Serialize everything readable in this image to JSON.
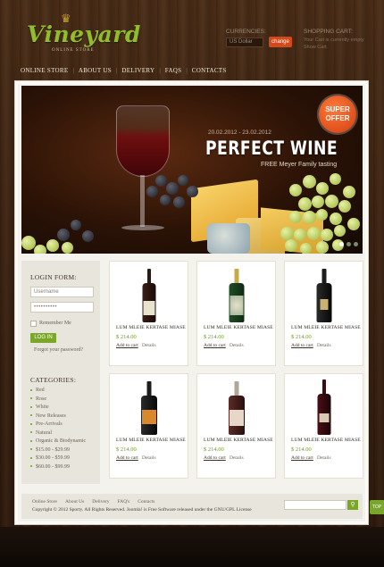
{
  "brand": {
    "name": "Vineyard",
    "tagline": "ONLINE STORE"
  },
  "header": {
    "currencies_label": "CURRENCIES:",
    "currency_selected": "US Dollar",
    "change_label": "change",
    "cart_label": "SHOPPING CART:",
    "cart_line1": "Your Cart is currently empty",
    "cart_line2": "Show Cart"
  },
  "nav": [
    "ONLINE STORE",
    "ABOUT US",
    "DELIVERY",
    "FAQS",
    "CONTACTS"
  ],
  "slider": {
    "date_range": "20.02.2012 - 23.02.2012",
    "title": "PERFECT WINE",
    "subtitle": "FREE Meyer Family tasting",
    "badge_line1": "SUPER",
    "badge_line2": "OFFER"
  },
  "login": {
    "title": "LOGIN FORM:",
    "username_placeholder": "Username",
    "password_value": "••••••••••",
    "remember_label": "Remember Me",
    "login_button": "LOG IN",
    "forgot_link": "Forgot your password?"
  },
  "categories": {
    "title": "CATEGORIES:",
    "items": [
      "Red",
      "Rose",
      "White",
      "New Releases",
      "Pre-Arrivals",
      "Natural",
      "Organic & Biodynamic",
      "$15.00 - $29.99",
      "$30.00 - $59.99",
      "$60.00 - $99.99"
    ]
  },
  "products": [
    {
      "name": "LUM MLEIE KERTASE MIASE",
      "price": "$ 214.00",
      "add": "Add to cart",
      "details": "Details"
    },
    {
      "name": "LUM MLEIE KERTASE MIASE",
      "price": "$ 214.00",
      "add": "Add to cart",
      "details": "Details"
    },
    {
      "name": "LUM MLEIE KERTASE MIASE",
      "price": "$ 214.00",
      "add": "Add to cart",
      "details": "Details"
    },
    {
      "name": "LUM MLEIE KERTASE MIASE",
      "price": "$ 214.00",
      "add": "Add to cart",
      "details": "Details"
    },
    {
      "name": "LUM MLEIE KERTASE MIASE",
      "price": "$ 214.00",
      "add": "Add to cart",
      "details": "Details"
    },
    {
      "name": "LUM MLEIE KERTASE MIASE",
      "price": "$ 214.00",
      "add": "Add to cart",
      "details": "Details"
    }
  ],
  "footer": {
    "links": [
      "Online Store",
      "About Us",
      "Delivery",
      "FAQ's",
      "Contacts"
    ],
    "copyright": "Copyright © 2012 Sporty. All Rights Reserved. Joomla! is Free Software released under the GNU/GPL License",
    "search_icon": "magnifier-icon",
    "top_label": "TOP"
  },
  "colors": {
    "accent_green": "#7aa62a",
    "accent_orange": "#d34a1a",
    "wood": "#3d2312"
  }
}
